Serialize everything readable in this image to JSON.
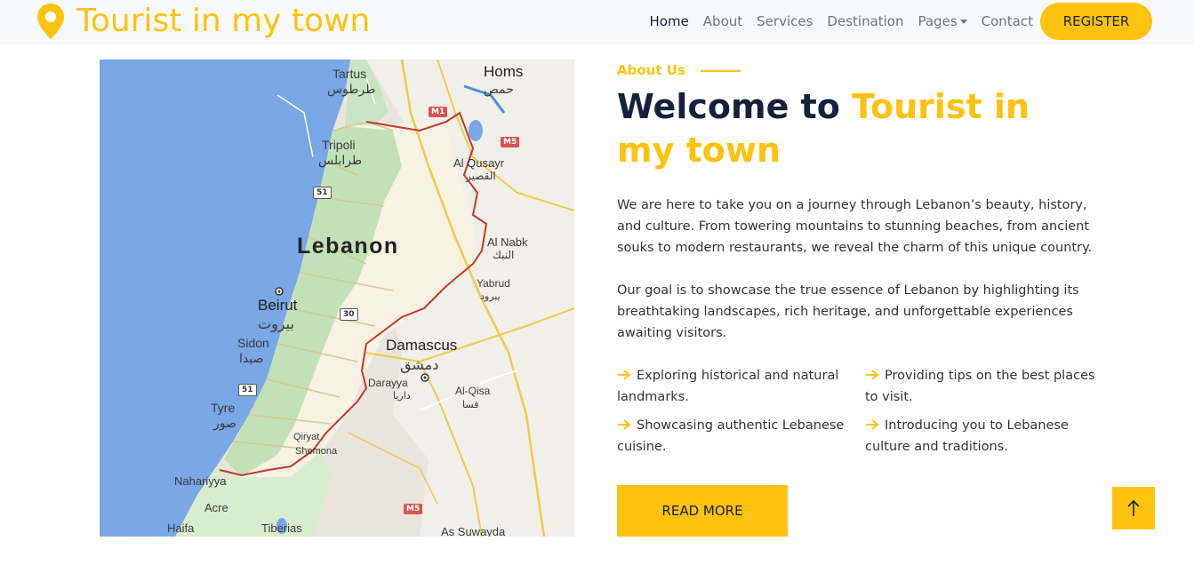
{
  "navbar": {
    "brand_text": "Tourist in my town",
    "links": [
      "Home",
      "About",
      "Services",
      "Destination",
      "Pages",
      "Contact"
    ],
    "register_label": "REGISTER",
    "accent": "#FEC20F"
  },
  "map": {
    "country": "Lebanon",
    "places": {
      "tartus": "Tartus",
      "tartus_ar": "طرطوس",
      "homs": "Homs",
      "homs_ar": "حمص",
      "tripoli": "Tripoli",
      "tripoli_ar": "طرابلس",
      "qusayr": "Al Qusayr",
      "qusayr_ar": "القصير",
      "nabk": "Al Nabk",
      "nabk_ar": "النبك",
      "yabrud": "Yabrud",
      "yabrud_ar": "يبرود",
      "beirut": "Beirut",
      "beirut_ar": "بيروت",
      "sidon": "Sidon",
      "sidon_ar": "صيدا",
      "damascus": "Damascus",
      "damascus_ar": "دمشق",
      "darayya": "Darayya",
      "darayya_ar": "داريا",
      "qisa": "Al-Qisa",
      "qisa_ar": "قسا",
      "tyre": "Tyre",
      "tyre_ar": "صور",
      "qiryat": "Qiryat",
      "shemona": "Shemona",
      "nahariyya": "Nahariyya",
      "acre": "Acre",
      "haifa": "Haifa",
      "tiberias": "Tiberias",
      "suwayda": "As Suwayda"
    },
    "roads": {
      "m1": "M1",
      "m5": "M5",
      "m5b": "M5",
      "r51a": "51",
      "r51b": "51",
      "r30": "30"
    }
  },
  "about": {
    "label": "About Us",
    "heading_main": "Welcome to ",
    "heading_accent": "Tourist in my town",
    "para1": "We are here to take you on a journey through Lebanon’s beauty, history, and culture. From towering mountains to stunning beaches, from ancient souks to modern restaurants, we reveal the charm of this unique country.",
    "para2": "Our goal is to showcase the true essence of Lebanon by highlighting its breathtaking landscapes, rich heritage, and unforgettable experiences awaiting visitors.",
    "features": [
      "Exploring historical and natural landmarks.",
      "Providing tips on the best places to visit.",
      "Showcasing authentic Lebanese cuisine.",
      "Introducing you to Lebanese culture and traditions."
    ],
    "read_more": "READ MORE"
  },
  "back_to_top_icon": "arrow-up-icon"
}
